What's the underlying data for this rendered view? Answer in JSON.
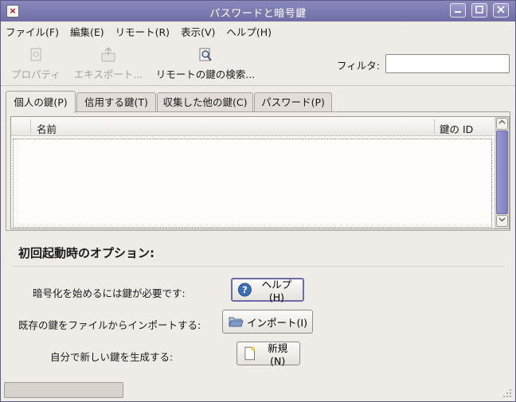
{
  "window": {
    "title": "パスワードと暗号鍵",
    "icon": "app-close-icon",
    "controls": [
      "minimize-icon",
      "maximize-icon",
      "close-icon"
    ]
  },
  "menu": [
    {
      "label": "ファイル(F)"
    },
    {
      "label": "編集(E)"
    },
    {
      "label": "リモート(R)"
    },
    {
      "label": "表示(V)"
    },
    {
      "label": "ヘルプ(H)"
    }
  ],
  "toolbar": {
    "properties": {
      "label": "プロパティ",
      "icon": "properties-icon",
      "enabled": false
    },
    "export": {
      "label": "エキスポート...",
      "icon": "export-icon",
      "enabled": false
    },
    "remote_search": {
      "label": "リモートの鍵の検索...",
      "icon": "search-remote-icon",
      "enabled": true
    },
    "filter_label": "フィルタ:",
    "filter_value": ""
  },
  "tabs": [
    {
      "label": "個人の鍵(P)",
      "active": true
    },
    {
      "label": "信用する鍵(T)",
      "active": false
    },
    {
      "label": "収集した他の鍵(C)",
      "active": false
    },
    {
      "label": "パスワード(P)",
      "active": false
    }
  ],
  "list": {
    "columns": [
      "名前",
      "鍵の ID"
    ],
    "rows": []
  },
  "options": {
    "title": "初回起動時のオプション:",
    "items": [
      {
        "label": "暗号化を始めるには鍵が必要です:",
        "button": "ヘルプ(H)",
        "icon": "help-icon"
      },
      {
        "label": "既存の鍵をファイルからインポートする:",
        "button": "インポート(I)",
        "icon": "folder-open-icon"
      },
      {
        "label": "自分で新しい鍵を生成する:",
        "button": "新規(N)",
        "icon": "new-document-icon"
      }
    ]
  },
  "colors": {
    "titlebar": "#7b7ab2",
    "accent": "#6d6ca8",
    "background": "#efebe7"
  }
}
